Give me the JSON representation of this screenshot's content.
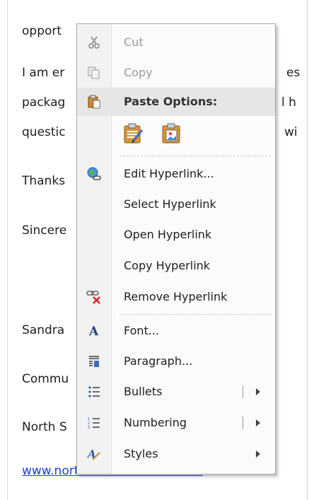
{
  "document": {
    "lines": [
      "opport",
      "I am er",
      "packag",
      "questic",
      "Thanks",
      "Sincere",
      "Sandra",
      "Commu",
      "North S"
    ],
    "right_fragments": [
      "es",
      "l h",
      "wi"
    ],
    "link_text": "www.northshoretravelinn.com"
  },
  "context_menu": {
    "cut": "Cut",
    "copy": "Copy",
    "paste_options_header": "Paste Options:",
    "edit_hyperlink": "Edit Hyperlink...",
    "select_hyperlink": "Select Hyperlink",
    "open_hyperlink": "Open Hyperlink",
    "copy_hyperlink": "Copy Hyperlink",
    "remove_hyperlink": "Remove Hyperlink",
    "font": "Font...",
    "paragraph": "Paragraph...",
    "bullets": "Bullets",
    "numbering": "Numbering",
    "styles": "Styles"
  },
  "icons": {
    "cut": "scissors-icon",
    "copy": "copy-icon",
    "paste": "clipboard-icon",
    "paste_keep_formatting": "paste-keep-formatting-icon",
    "paste_picture": "paste-picture-icon",
    "edit_hyperlink": "globe-link-icon",
    "remove_hyperlink": "broken-link-icon",
    "font": "font-a-icon",
    "paragraph": "paragraph-icon",
    "bullets": "bullet-list-icon",
    "numbering": "numbered-list-icon",
    "styles": "styles-icon"
  },
  "colors": {
    "link": "#1a3fd6",
    "header_bg": "#e6e6e6",
    "disabled_text": "#9a9a9a"
  }
}
